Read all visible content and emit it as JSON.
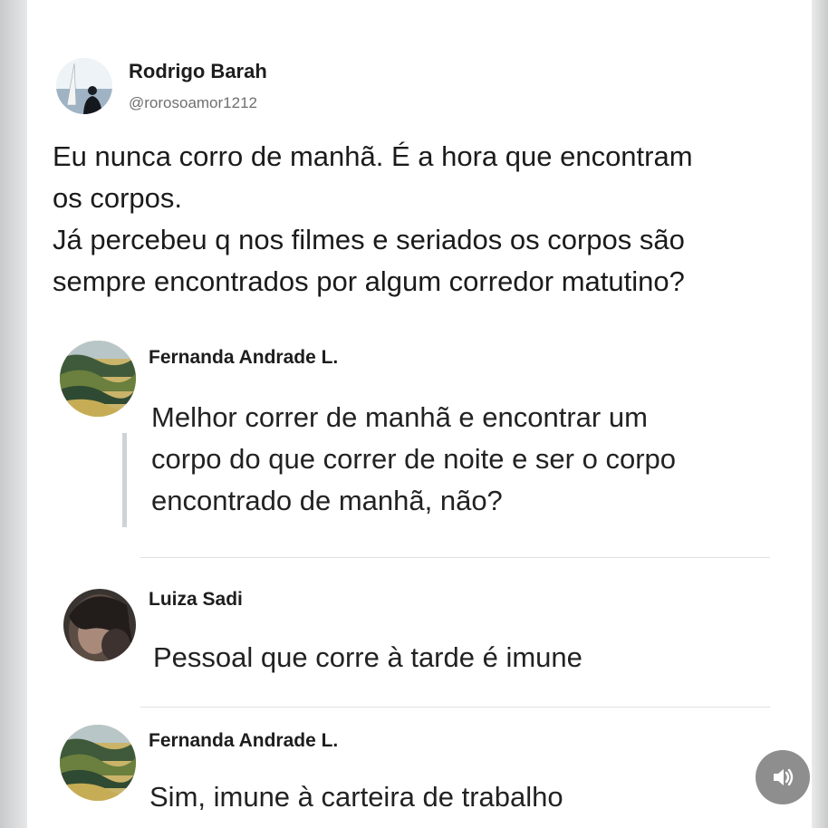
{
  "post": {
    "author_name": "Rodrigo Barah",
    "author_handle": "@rorosoamor1212",
    "text_lines": [
      "Eu nunca corro de manhã. É a hora que encontram",
      "os corpos.",
      "Já percebeu q nos filmes e seriados os corpos são",
      "sempre encontrados por algum corredor matutino?"
    ]
  },
  "replies": [
    {
      "author_name": "Fernanda Andrade L.",
      "text_lines": [
        "Melhor correr de manhã e encontrar um",
        "corpo do que correr de noite e ser o corpo",
        "encontrado de manhã, não?"
      ]
    },
    {
      "author_name": "Luiza Sadi",
      "text_lines": [
        "Pessoal que corre à tarde é imune"
      ]
    },
    {
      "author_name": "Fernanda Andrade L.",
      "text_lines": [
        "Sim, imune à carteira de trabalho"
      ]
    }
  ],
  "controls": {
    "sound_icon": "speaker-icon"
  }
}
